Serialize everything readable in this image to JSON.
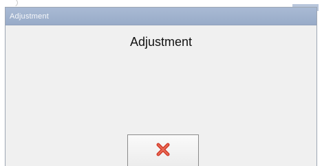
{
  "window": {
    "title": "Adjustment"
  },
  "dialog": {
    "heading": "Adjustment"
  },
  "buttons": {
    "close_icon": "close-x-icon",
    "close_icon_color": "#d23a2a"
  },
  "colors": {
    "titlebar": "#a3b4cf",
    "dialog_background": "#f0f0f0"
  }
}
